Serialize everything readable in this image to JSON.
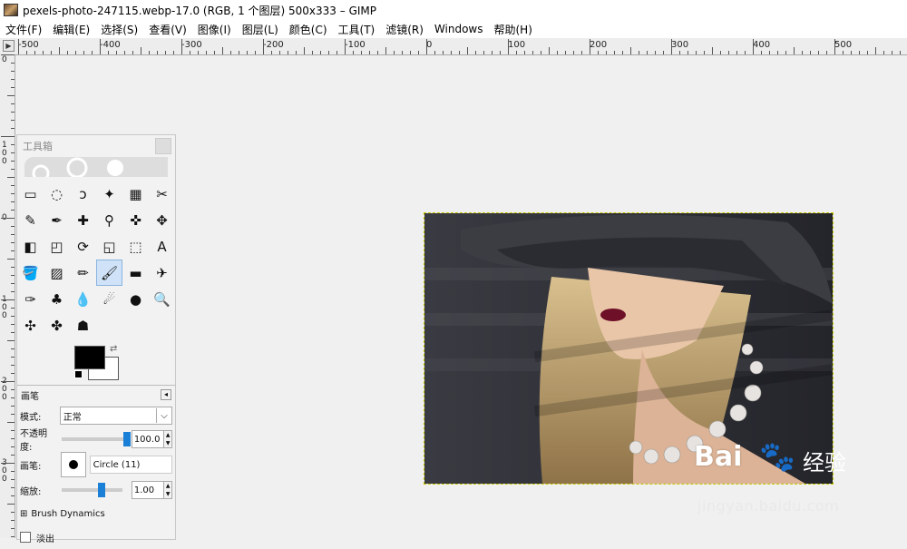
{
  "window": {
    "title": "pexels-photo-247115.webp-17.0 (RGB, 1 个图层) 500x333 – GIMP"
  },
  "menu": {
    "items": [
      "文件(F)",
      "编辑(E)",
      "选择(S)",
      "查看(V)",
      "图像(I)",
      "图层(L)",
      "颜色(C)",
      "工具(T)",
      "滤镜(R)",
      "Windows",
      "帮助(H)"
    ]
  },
  "ruler": {
    "corner_glyph": "▶",
    "top_labels": [
      "-500",
      "-400",
      "-300",
      "-200",
      "-100",
      "0",
      "100",
      "200",
      "300",
      "400",
      "500"
    ],
    "left_labels": [
      "0",
      "100",
      "0",
      "100",
      "200",
      "300"
    ]
  },
  "toolbox": {
    "title": "工具箱",
    "tools": [
      "rect-select-icon",
      "ellipse-select-icon",
      "free-select-icon",
      "fuzzy-select-icon",
      "select-by-color-icon",
      "scissors-select-icon",
      "foreground-select-icon",
      "paths-icon",
      "color-picker-icon",
      "zoom-icon",
      "measure-icon",
      "move-icon",
      "align-icon",
      "crop-icon",
      "rotate-icon",
      "scale-icon",
      "shear-icon",
      "text-icon",
      "bucket-fill-icon",
      "blend-icon",
      "pencil-icon",
      "paintbrush-icon",
      "eraser-icon",
      "airbrush-icon",
      "ink-icon",
      "clone-icon",
      "blur-icon",
      "smudge-icon",
      "dodge-burn-icon",
      "magnify-icon",
      "flip-icon",
      "cage-icon",
      "heal-icon"
    ],
    "tool_glyphs": [
      "▭",
      "◌",
      "ↄ",
      "✦",
      "▦",
      "✂",
      "✎",
      "✒",
      "✚",
      "⚲",
      "✜",
      "✥",
      "◧",
      "◰",
      "⟳",
      "◱",
      "⬚",
      "A",
      "🪣",
      "▨",
      "✏",
      "🖌",
      "▬",
      "✈",
      "✑",
      "♣",
      "💧",
      "☄",
      "●",
      "🔍",
      "✣",
      "✤",
      "☗"
    ],
    "active_tool_index": 21,
    "colors": {
      "foreground": "#000000",
      "background": "#ffffff"
    },
    "swap_glyph": "⇄"
  },
  "options": {
    "tool_name": "画笔",
    "mode_label": "模式:",
    "mode_value": "正常",
    "opacity_label": "不透明度:",
    "opacity_value": "100.0",
    "opacity_fraction": 1.0,
    "brush_label": "画笔:",
    "brush_value": "Circle (11)",
    "scale_label": "缩放:",
    "scale_value": "1.00",
    "dynamics_expander": "⊞",
    "dynamics_label": "Brush Dynamics",
    "fade_label": "淡出",
    "panel_button_glyph": "◂",
    "dropdown_glyph": "⌵",
    "spin_up": "▲",
    "spin_down": "▼"
  },
  "watermark": {
    "logo": "Bai",
    "paw": "🐾",
    "chinese": "经验",
    "url": "jingyan.baidu.com"
  }
}
